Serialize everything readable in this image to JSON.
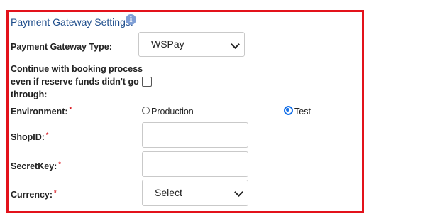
{
  "section": {
    "title": "Payment Gateway Settings:",
    "info_icon": "info-icon"
  },
  "gateway_type": {
    "label": "Payment Gateway Type:",
    "selected": "WSPay"
  },
  "continue_booking": {
    "label_line1": "Continue with booking process",
    "label_line2": "even if reserve funds didn't go",
    "label_line3": "through:",
    "checked": false
  },
  "environment": {
    "label": "Environment:",
    "required_mark": "*",
    "options": [
      {
        "label": "Production",
        "selected": false
      },
      {
        "label": "Test",
        "selected": true
      }
    ]
  },
  "shop_id": {
    "label": "ShopID:",
    "required_mark": "*",
    "value": ""
  },
  "secret_key": {
    "label": "SecretKey:",
    "required_mark": "*",
    "value": ""
  },
  "currency": {
    "label": "Currency:",
    "required_mark": "*",
    "selected": "Select"
  },
  "colors": {
    "border": "#e3121b",
    "title": "#1f4e8c",
    "required": "#d8121b",
    "radio_accent": "#1a73e8"
  }
}
